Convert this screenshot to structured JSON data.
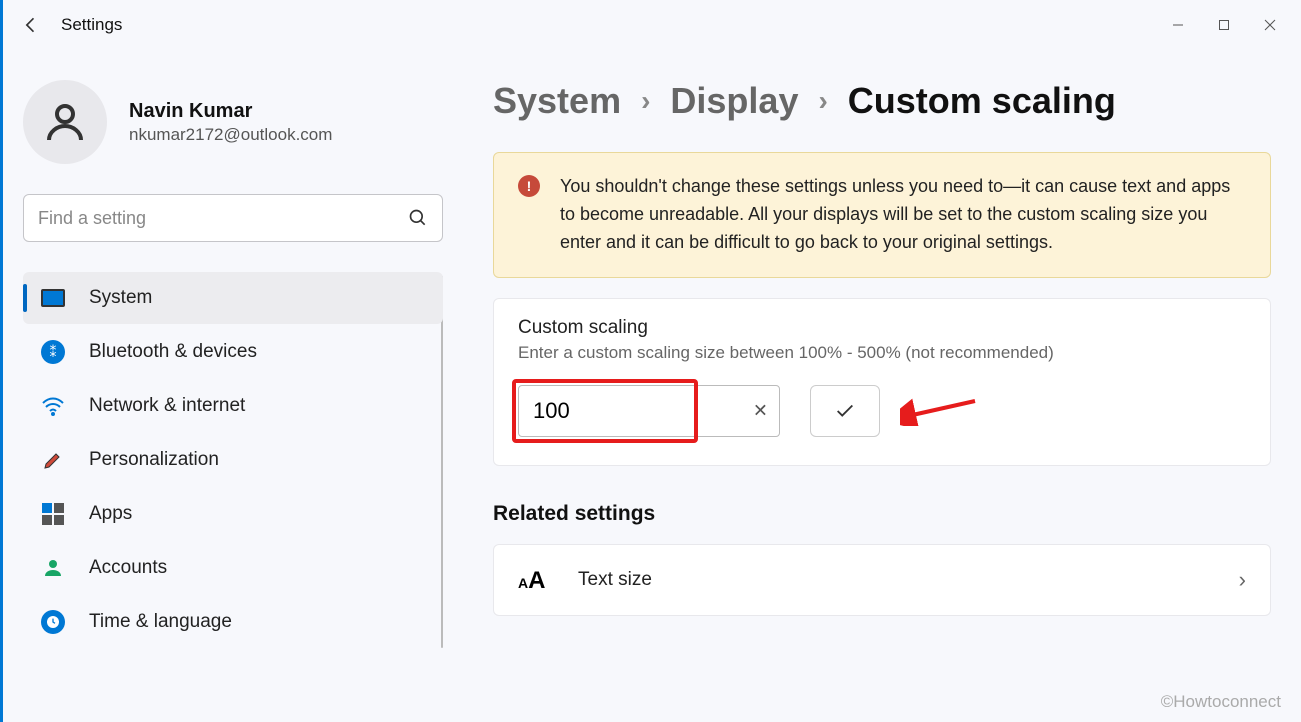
{
  "app": {
    "title": "Settings"
  },
  "user": {
    "name": "Navin Kumar",
    "email": "nkumar2172@outlook.com"
  },
  "search": {
    "placeholder": "Find a setting"
  },
  "nav": {
    "items": [
      {
        "label": "System"
      },
      {
        "label": "Bluetooth & devices"
      },
      {
        "label": "Network & internet"
      },
      {
        "label": "Personalization"
      },
      {
        "label": "Apps"
      },
      {
        "label": "Accounts"
      },
      {
        "label": "Time & language"
      }
    ]
  },
  "breadcrumb": {
    "root": "System",
    "mid": "Display",
    "current": "Custom scaling"
  },
  "warning": {
    "text": "You shouldn't change these settings unless you need to—it can cause text and apps to become unreadable. All your displays will be set to the custom scaling size you enter and it can be difficult to go back to your original settings."
  },
  "custom_scaling": {
    "title": "Custom scaling",
    "subtitle": "Enter a custom scaling size between 100% - 500% (not recommended)",
    "value": "100"
  },
  "related": {
    "heading": "Related settings",
    "text_size": "Text size"
  },
  "watermark": "©Howtoconnect"
}
